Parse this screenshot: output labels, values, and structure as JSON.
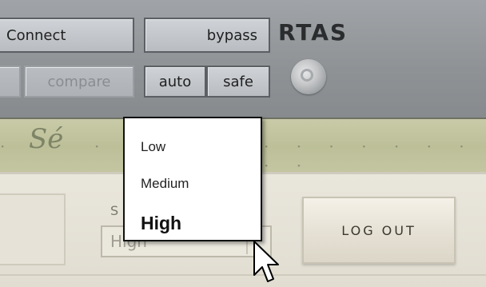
{
  "header": {
    "buttons": {
      "connect": "Connect",
      "bypass": "bypass",
      "compare": "compare",
      "auto": "auto",
      "safe": "safe"
    },
    "format_label": "RTAS"
  },
  "band": {
    "logo_text": "Sé"
  },
  "panel": {
    "select_label": "S",
    "select_value": "High",
    "logout_label": "LOG OUT"
  },
  "dropdown": {
    "options": [
      "Low",
      "Medium",
      "High"
    ],
    "selected_option": "High"
  },
  "colors": {
    "header_bg": "#8e9295",
    "band_bg": "#bcbf98",
    "panel_bg": "#e6e2d7",
    "dropdown_bg": "#ffffff"
  },
  "icons": {
    "rtas_knob": "knob-icon",
    "cursor": "mouse-pointer-icon"
  }
}
